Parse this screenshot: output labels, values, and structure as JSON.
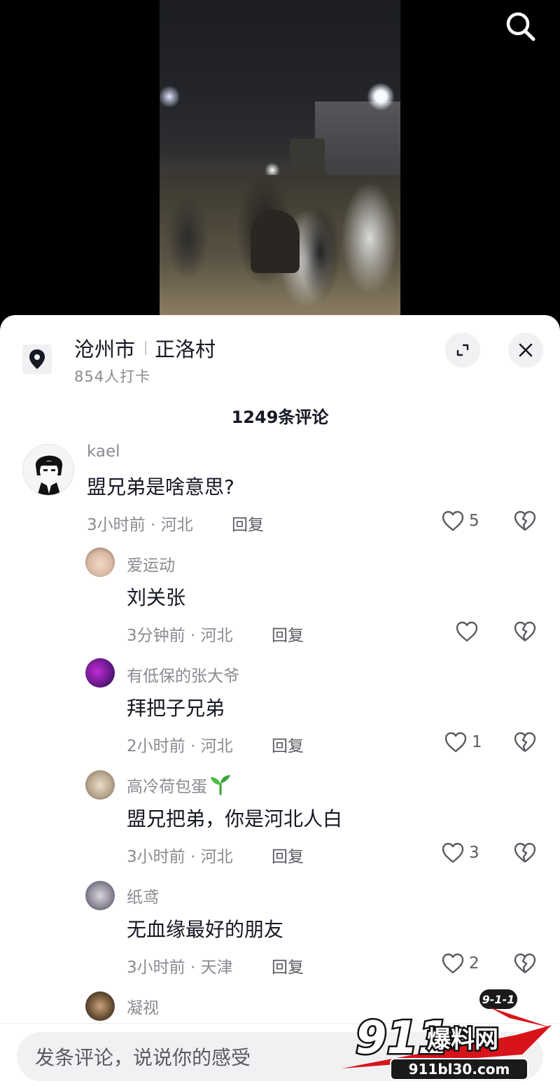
{
  "location": {
    "city": "沧州市",
    "place": "正洛村",
    "checkins": "854人打卡"
  },
  "comments_header": {
    "count_label": "1249条评论"
  },
  "comments": [
    {
      "user": "kael",
      "text": "盟兄弟是啥意思?",
      "meta": "3小时前 · 河北",
      "reply": "回复",
      "likes": "5"
    }
  ],
  "replies": [
    {
      "user": "爱运动",
      "text": "刘关张",
      "meta": "3分钟前 · 河北",
      "reply": "回复",
      "likes": ""
    },
    {
      "user": "有低保的张大爷",
      "text": "拜把子兄弟",
      "meta": "2小时前 · 河北",
      "reply": "回复",
      "likes": "1"
    },
    {
      "user": "高冷荷包蛋",
      "text": "盟兄把弟，你是河北人白",
      "meta": "3小时前 · 河北",
      "reply": "回复",
      "likes": "3"
    },
    {
      "user": "纸鸢",
      "text": "无血缘最好的朋友",
      "meta": "3小时前 · 天津",
      "reply": "回复",
      "likes": "2"
    },
    {
      "user": "凝视",
      "text": "",
      "meta": "",
      "reply": "",
      "likes": ""
    }
  ],
  "input": {
    "placeholder": "发条评论，说说你的感受"
  },
  "watermark": {
    "badge": "9-1-1",
    "brand_num": "911",
    "brand_text": "爆料网",
    "url": "911bl30.com"
  },
  "colors": {
    "text_primary": "#161823",
    "text_secondary": "#8a8b91",
    "sheet_bg": "#ffffff",
    "watermark_red": "#d7141a"
  },
  "icons": [
    "search-icon",
    "location-pin-icon",
    "expand-icon",
    "close-icon",
    "heart-icon",
    "broken-heart-icon",
    "sprout-icon"
  ]
}
